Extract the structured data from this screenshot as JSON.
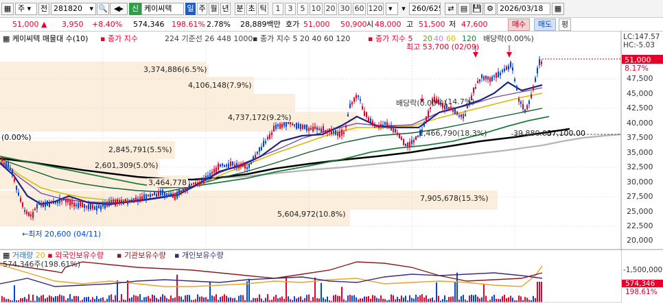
{
  "toolbar": {
    "market_select": "주",
    "jeon_label": "전",
    "code_value": "281820",
    "sin_badge": "신",
    "stock_name": "케이씨텍",
    "period_buttons": [
      "일",
      "주",
      "월",
      "년",
      "분",
      "초",
      "틱"
    ],
    "interval_buttons": [
      "1",
      "3",
      "5",
      "10",
      "20",
      "30",
      "60",
      "120"
    ],
    "count_value": "260/625",
    "date_value": "2026/03/18"
  },
  "quote": {
    "price": "51,000",
    "up_arrow": "▲",
    "change": "3,950",
    "change_pct": "+8.40%",
    "volume": "574,346",
    "volume_pct": "198.61%",
    "turnover_pct": "2.78%",
    "amount": "28,889백만",
    "ask_label": "호가",
    "ask": "51,000",
    "bid": "50,900",
    "open_label": "시",
    "open": "48,000",
    "high_label": "고",
    "high": "51,500",
    "low_label": "저",
    "low": "47,600",
    "buy_button": "매수",
    "sell_button": "매도",
    "eval_button": "평"
  },
  "legend": {
    "title": "케이씨텍 매물대 수(10)",
    "close_index": "종가 지수",
    "ma_line": "224 기준선 26 448 1000",
    "ma_line_value": "1000",
    "close_index2": "종가 지수 5 20 40 60 120",
    "close_index3": "종가 지수 5",
    "ma_parts": [
      "20",
      "40",
      "60",
      "120"
    ],
    "dividend": "배당락(0.00%)"
  },
  "annotations": {
    "high_label": "최고 53,700 (02/09)",
    "low_label": "←최저 20,600 (04/11)",
    "origin_label": "(0.00%)",
    "dividend_mid": "배당락(0.00%)",
    "label_14": "(14.7%)",
    "label_18": "1,466,790(18.3%)",
    "price_39880": "39,880.00",
    "price_37100": "37,100.00"
  },
  "volume_profile": [
    {
      "label": "3,374,886(6.5%)"
    },
    {
      "label": "4,106,148(7.9%)"
    },
    {
      "label": "4,737,172(9.2%)"
    },
    {
      "label": "2,845,791(5.5%)"
    },
    {
      "label": "2,601,309(5.0%)"
    },
    {
      "label": "3,464,778"
    },
    {
      "label": "5,604,972(10.8%)"
    },
    {
      "label": "7,905,678(15.3%)"
    }
  ],
  "y_axis": {
    "lc": "LC:147.57",
    "hc": "HC:-5.03",
    "current": "51,000",
    "current_pct": "8.17%",
    "ticks": [
      "47,500",
      "45,000",
      "42,500",
      "40,000",
      "37,500",
      "35,000",
      "32,500",
      "30,000",
      "27,500",
      "25,000",
      "22,500",
      "20,000"
    ]
  },
  "sub": {
    "volume_label": "거래량",
    "volume_ma": "20",
    "foreign": "외국인보유수량",
    "inst": "기관보유수량",
    "indiv": "개인보유수량",
    "vol_readout": "574,346주(198.61%)",
    "axis_label": "-1,500,000",
    "right_vol": "574,346",
    "right_pct": "198.61%"
  },
  "colors": {
    "up": "#e4002b",
    "down": "#0046d5",
    "profile": "#fbeedd",
    "ma_black": "#000000",
    "ma_navy": "#1a237e",
    "ma_green": "#1b7a3a"
  }
}
